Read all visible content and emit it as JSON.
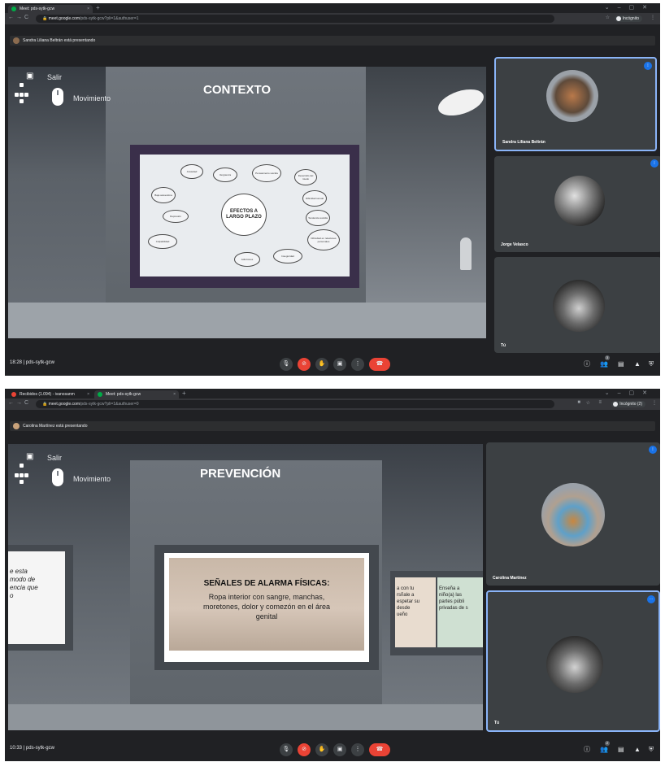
{
  "shot1": {
    "tabs": [
      {
        "label": "Meet: pds-sytk-gcw",
        "active": true
      }
    ],
    "url_domain": "meet.google.com",
    "url_path": "/pds-sytk-gcw?pli=1&authuser=1",
    "profile_label": "Incógnito",
    "presenting_text": "Sandra Liliana Beltrán está presentando",
    "hud": {
      "exit_label": "Salir",
      "move_label": "Movimiento"
    },
    "scene_title": "CONTEXTO",
    "mindmap": {
      "center": "EFECTOS A LARGO PLAZO",
      "nodes": [
        "Ansiedad",
        "Vergüenza",
        "Pensamiento suicida",
        "Baja autoestima",
        "Depresión",
        "Culpabilidad",
        "Desarrollo del miedo",
        "Dificultad sexual",
        "Tendencia suicida",
        "Dificultad en relaciones personales",
        "Inseguridad",
        "Adicciones"
      ]
    },
    "participants": [
      {
        "name": "Sandra Liliana Beltrán",
        "speaking": true,
        "active": true
      },
      {
        "name": "Jorge Velasco",
        "speaking": true,
        "active": false
      },
      {
        "name": "Tú",
        "speaking": false,
        "active": false
      }
    ],
    "time": "18:28",
    "meeting_code": "pds-sytk-gcw",
    "people_count": "3"
  },
  "shot2": {
    "tabs": [
      {
        "label": "Recibidos (1.094) - ivanosanm",
        "active": false
      },
      {
        "label": "Meet: pds-sytk-gcw",
        "active": true
      }
    ],
    "url_domain": "meet.google.com",
    "url_path": "/pds-sytk-gcw?pli=1&authuser=0",
    "profile_label": "Incógnito (2)",
    "presenting_text": "Carolina Martínez está presentando",
    "hud": {
      "exit_label": "Salir",
      "move_label": "Movimiento"
    },
    "scene_title": "PREVENCIÓN",
    "sign_heading": "SEÑALES DE ALARMA FÍSICAS:",
    "sign_body": "Ropa interior con sangre, manchas, moretones, dolor y comezón en el área genital",
    "left_fragment": "e esta\n modo de\nencia que\no",
    "right_fragment_a": "a con tu\nrsñale a\nespetar su\ndesde\nueño",
    "right_fragment_b": "Enseña a\nniño(a) las\npartes públi\nprivadas de s",
    "participants": [
      {
        "name": "Carolina Martínez",
        "speaking": true,
        "active": false
      },
      {
        "name": "Tú",
        "speaking": false,
        "active": true
      }
    ],
    "time": "10:33",
    "meeting_code": "pds-sytk-gcw",
    "people_count": "2"
  },
  "icons": {
    "mic": "🎙",
    "cam_off": "⊘",
    "hand": "✋",
    "present": "▣",
    "more": "⋮",
    "hangup": "☎",
    "info": "ⓘ",
    "people": "👥",
    "chat": "▤",
    "activities": "▲",
    "lock": "⛨"
  },
  "colors": {
    "meet_bg": "#202124",
    "tile_bg": "#3c4043",
    "accent": "#8ab4f8",
    "danger": "#ea4335",
    "speaking": "#1a73e8"
  }
}
